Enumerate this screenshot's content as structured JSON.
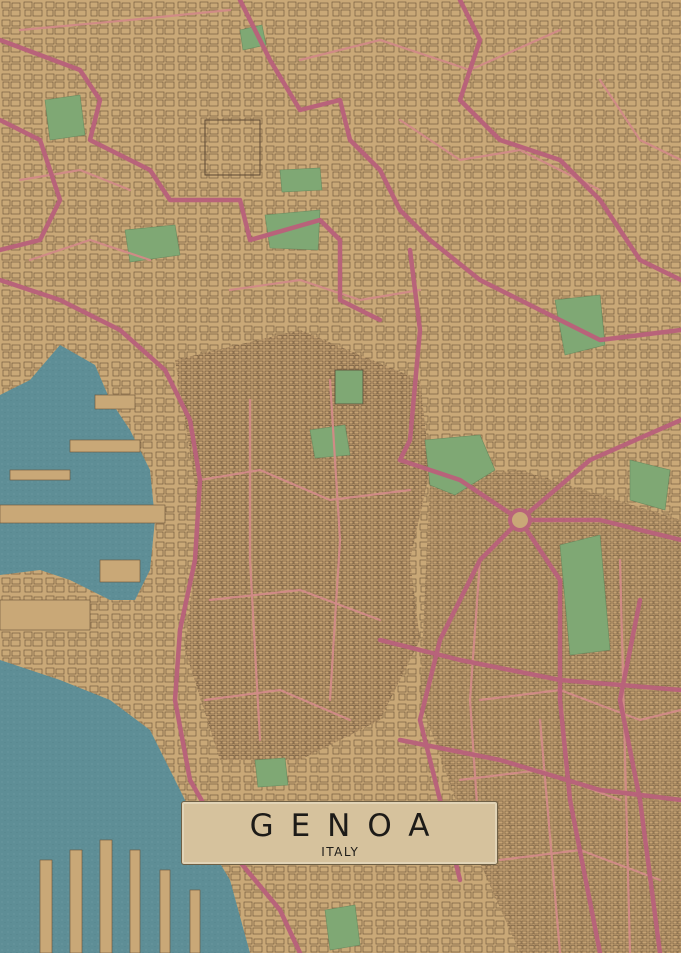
{
  "poster": {
    "city": "GENOA",
    "country": "ITALY"
  },
  "colors": {
    "land": "#c9a877",
    "water": "#5e8e96",
    "parks": "#7fa874",
    "major_roads": "#b8637a",
    "minor_roads": "#d08b86",
    "building_outline": "#5a4632",
    "label_background": "#d6c29d"
  }
}
